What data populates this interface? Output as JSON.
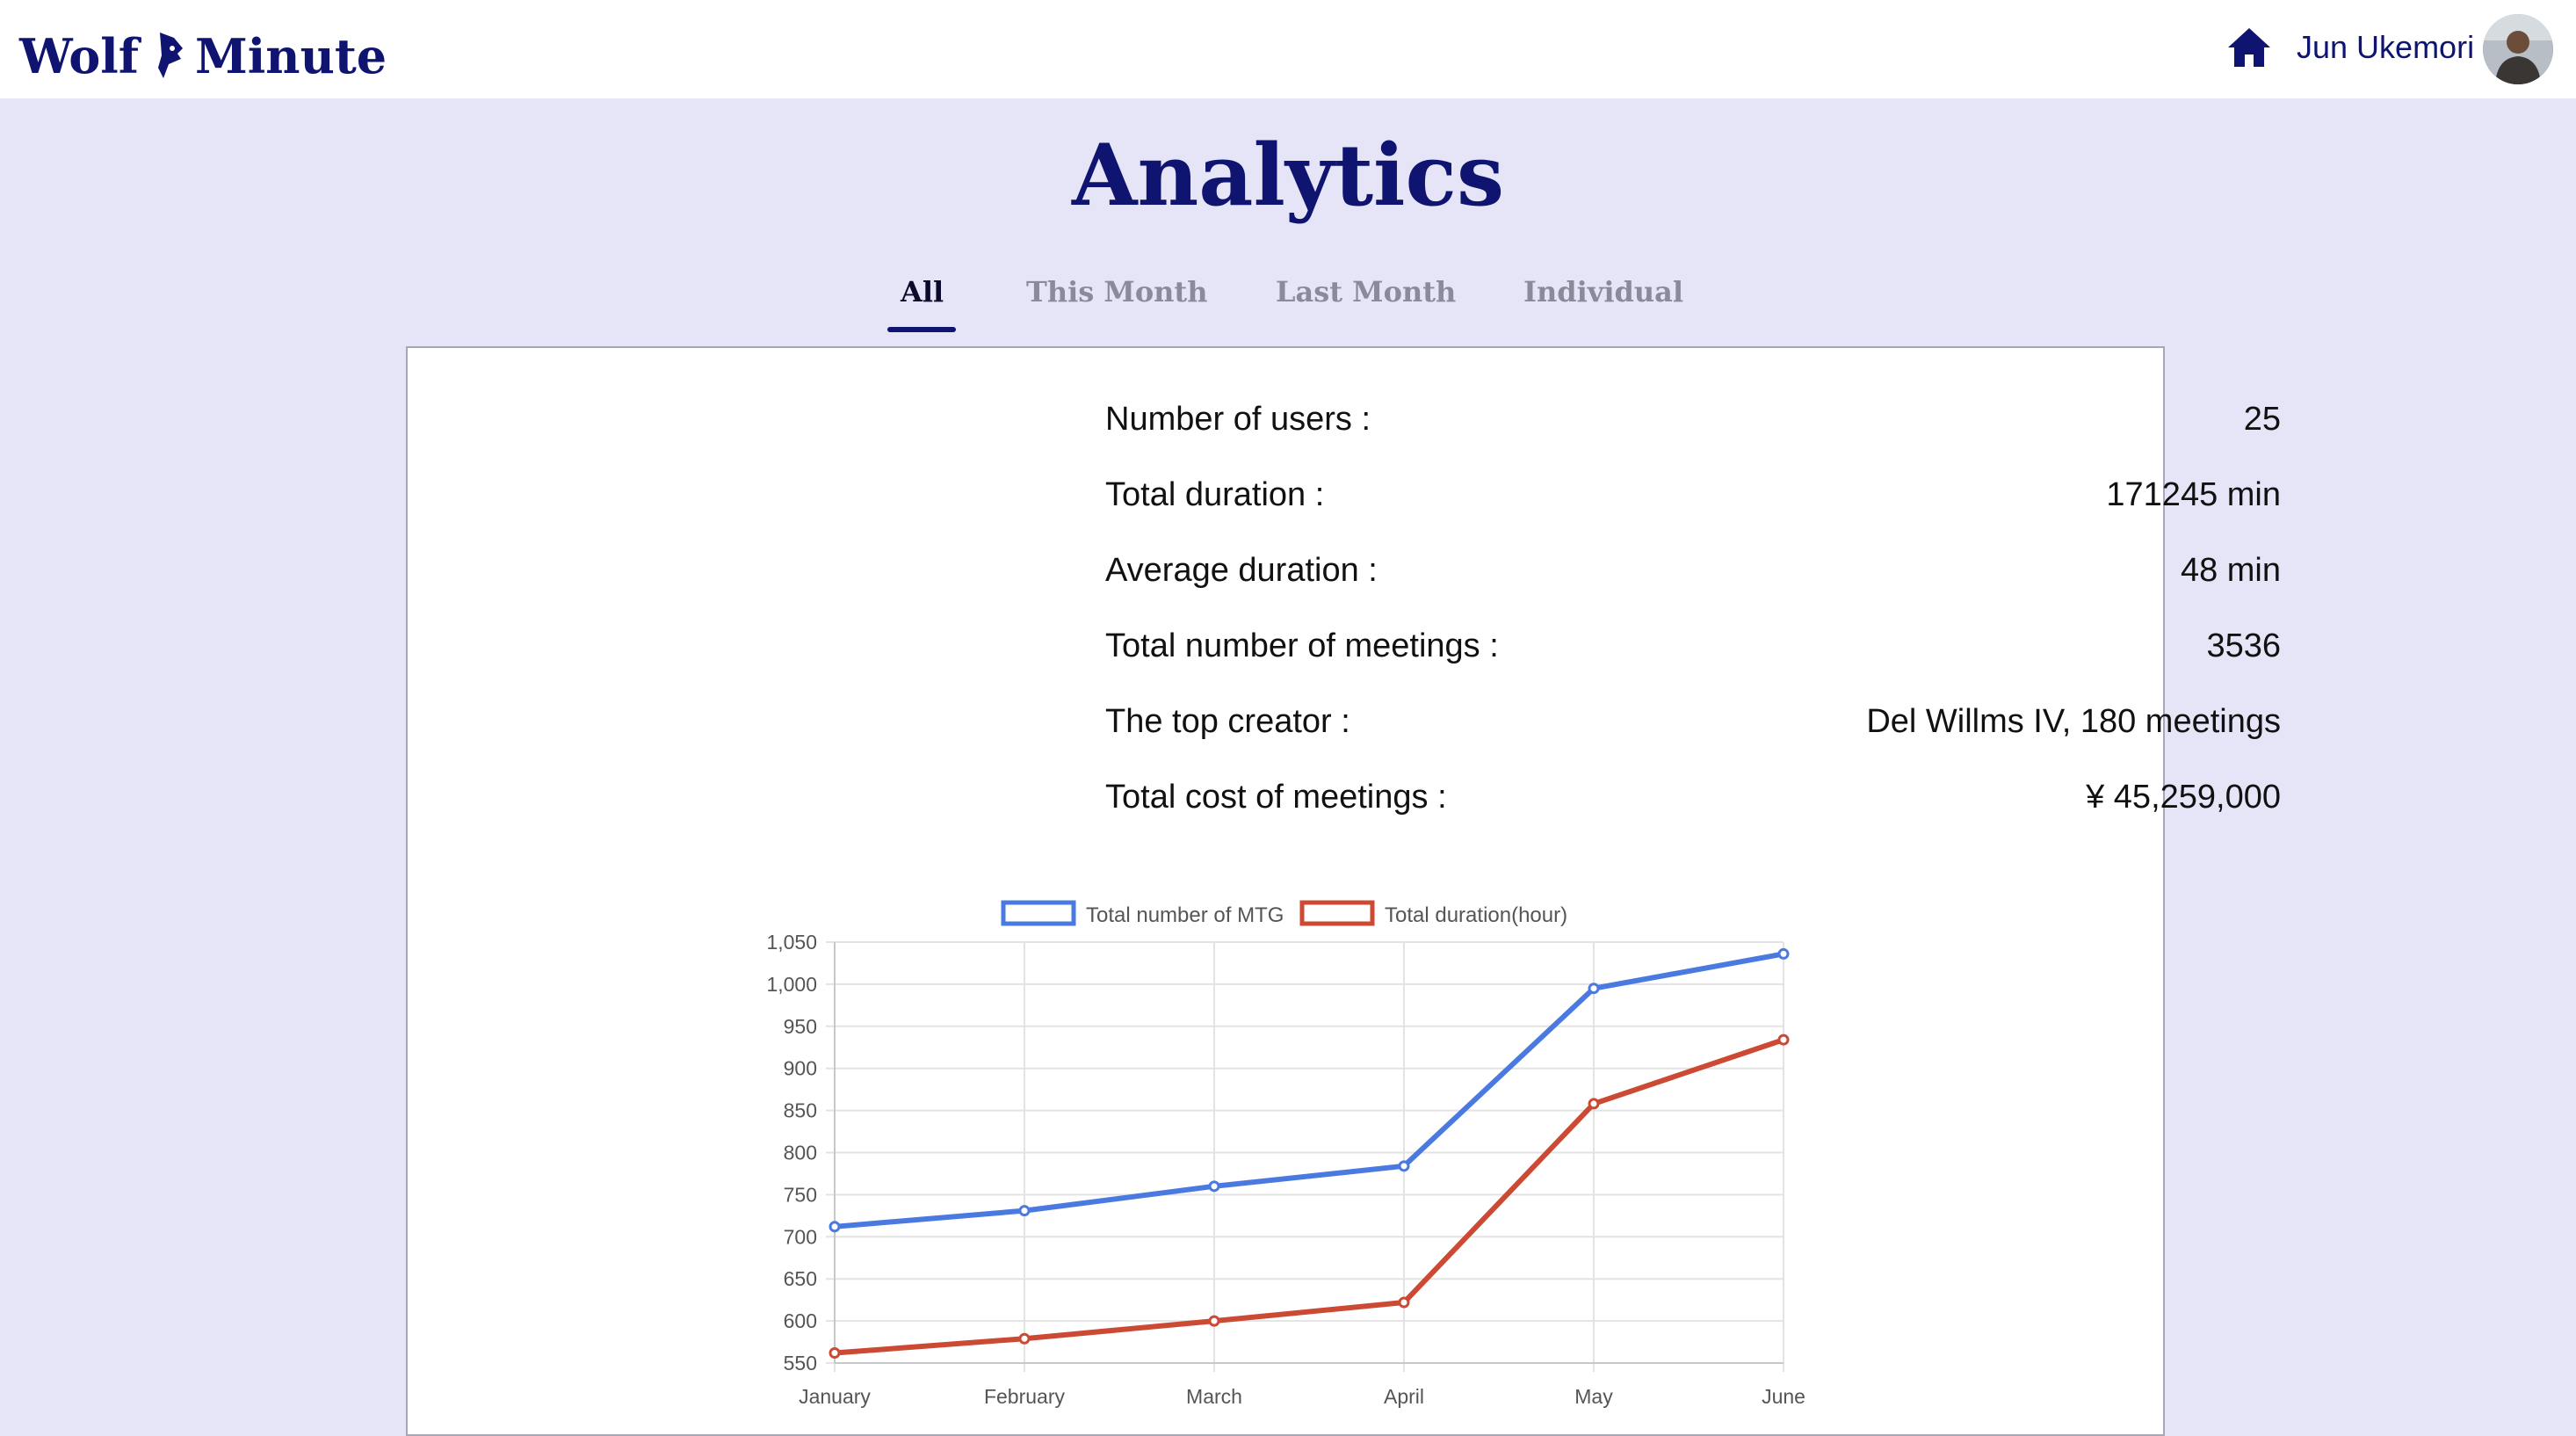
{
  "header": {
    "logo_left": "Wolf",
    "logo_right": "Minute",
    "username": "Jun Ukemori"
  },
  "page": {
    "title": "Analytics"
  },
  "tabs": [
    {
      "label": "All",
      "active": true
    },
    {
      "label": "This Month",
      "active": false
    },
    {
      "label": "Last Month",
      "active": false
    },
    {
      "label": "Individual",
      "active": false
    }
  ],
  "stats": [
    {
      "label": "Number of users :",
      "value": "25"
    },
    {
      "label": "Total duration :",
      "value": "171245 min"
    },
    {
      "label": "Average duration :",
      "value": "48 min"
    },
    {
      "label": "Total number of meetings :",
      "value": "3536"
    },
    {
      "label": "The top creator :",
      "value": "Del Willms IV, 180 meetings"
    },
    {
      "label": "Total cost of meetings :",
      "value": "¥ 45,259,000"
    }
  ],
  "icons": {
    "home": "home-icon",
    "avatar": "user-avatar"
  },
  "colors": {
    "brand": "#0e1470",
    "background": "#e6e5f7",
    "series1": "#4a7ae0",
    "series2": "#cc4a34"
  },
  "chart_data": {
    "type": "line",
    "categories": [
      "January",
      "February",
      "March",
      "April",
      "May",
      "June"
    ],
    "series": [
      {
        "name": "Total number of MTG",
        "values": [
          712,
          731,
          760,
          784,
          995,
          1036
        ],
        "color": "#4a7ae0"
      },
      {
        "name": "Total duration(hour)",
        "values": [
          562,
          579,
          600,
          622,
          858,
          934
        ],
        "color": "#cc4a34"
      }
    ],
    "y_ticks": [
      "1,050",
      "1,000",
      "950",
      "900",
      "850",
      "800",
      "750",
      "700",
      "650",
      "600",
      "550"
    ],
    "ylim": [
      550,
      1050
    ],
    "grid": true,
    "legend": "top"
  }
}
